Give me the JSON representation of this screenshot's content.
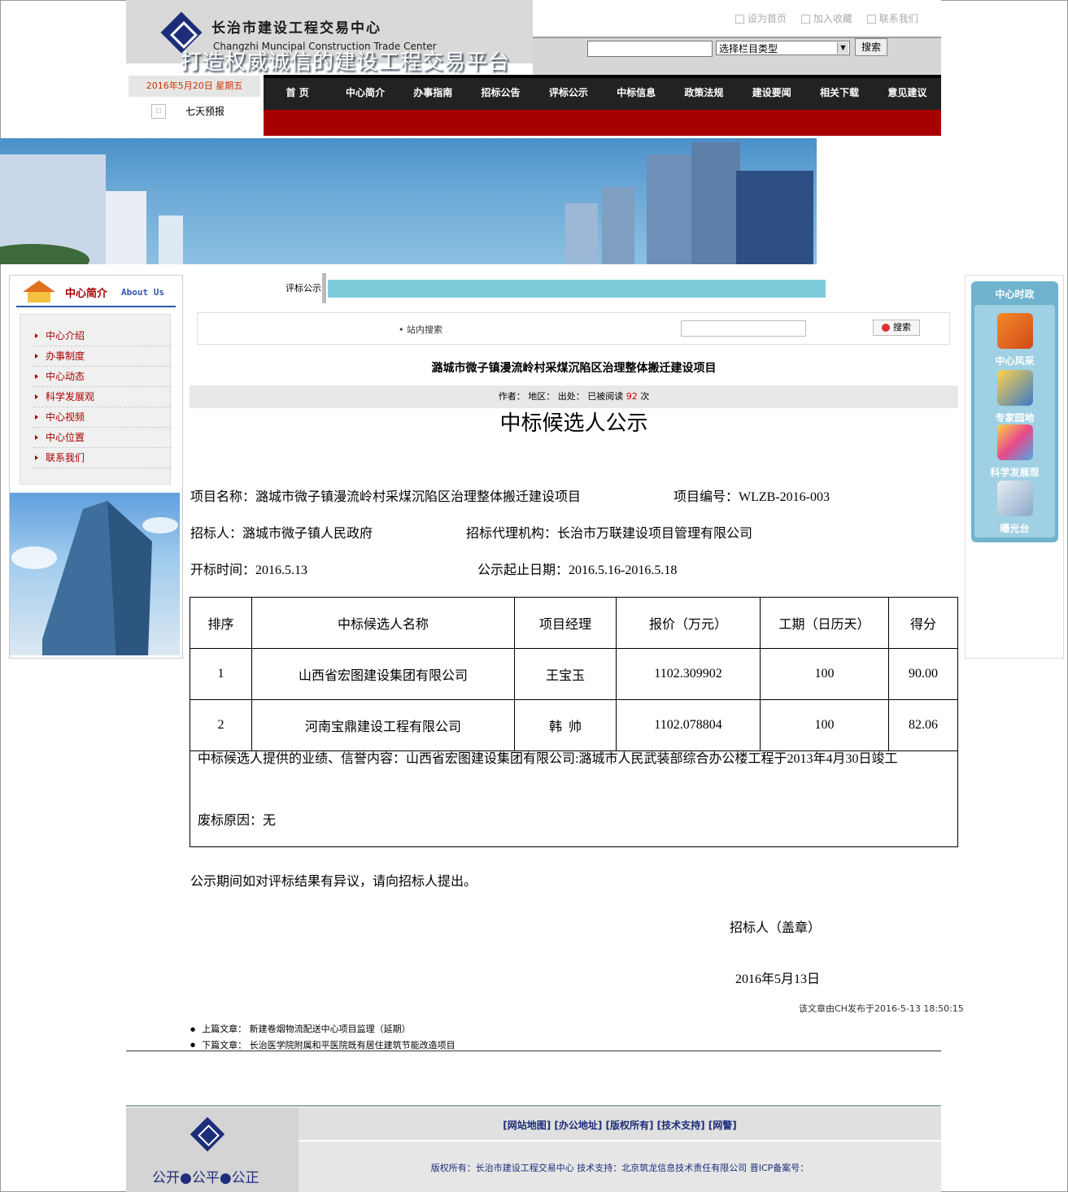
{
  "header": {
    "logo_cn": "长治市建设工程交易中心",
    "logo_en": "Changzhi Muncipal Construction Trade Center",
    "top_links": [
      "设为首页",
      "加入收藏",
      "联系我们"
    ],
    "search_select": "选择栏目类型",
    "search_button": "搜索",
    "date": "2016年5月20日  星期五",
    "weather": "七天预报"
  },
  "nav": [
    "首 页",
    "中心简介",
    "办事指南",
    "招标公告",
    "评标公示",
    "中标信息",
    "政策法规",
    "建设要闻",
    "相关下载",
    "意见建议"
  ],
  "banner": {
    "slogan": "打造权威诚信的建设工程交易平台"
  },
  "left": {
    "title": "中心简介",
    "subtitle": "About Us",
    "menu": [
      "中心介绍",
      "办事制度",
      "中心动态",
      "科学发展观",
      "中心视频",
      "中心位置",
      "联系我们"
    ]
  },
  "right": {
    "title": "中心时政",
    "items": [
      "中心风采",
      "专家园地",
      "科学发展观",
      "曝光台"
    ]
  },
  "main": {
    "breadcrumb": "评标公示",
    "site_search_label": "• 站内搜索",
    "site_search_button": "搜索",
    "article_title": "潞城市微子镇漫流岭村采煤沉陷区治理整体搬迁建设项目",
    "meta": {
      "author": "作者：",
      "region": "地区：",
      "source": "出处：",
      "read_prefix": "已被阅读",
      "read_count": "92",
      "read_suffix": "次"
    },
    "heading": "中标候选人公示",
    "project_name": "项目名称：潞城市微子镇漫流岭村采煤沉陷区治理整体搬迁建设项目",
    "project_no": "项目编号：WLZB-2016-003",
    "tenderer": "招标人：潞城市微子镇人民政府",
    "agency": "招标代理机构：长治市万联建设项目管理有限公司",
    "open_time": "开标时间：2016.5.13",
    "notice_period": "公示起止日期：2016.5.16-2016.5.18",
    "table": {
      "headers": [
        "排序",
        "中标候选人名称",
        "项目经理",
        "报价（万元）",
        "工期（日历天）",
        "得分"
      ],
      "rows": [
        [
          "1",
          "山西省宏图建设集团有限公司",
          "王宝玉",
          "1102.309902",
          "100",
          "90.00"
        ],
        [
          "2",
          "河南宝鼎建设工程有限公司",
          "韩  帅",
          "1102.078804",
          "100",
          "82.06"
        ]
      ]
    },
    "performance_note": "中标候选人提供的业绩、信誉内容：山西省宏图建设集团有限公司:潞城市人民武装部综合办公楼工程于2013年4月30日竣工",
    "void_reason": "废标原因：无",
    "objection": "公示期间如对评标结果有异议，请向招标人提出。",
    "signature": "招标人（盖章）",
    "sign_date": "2016年5月13日",
    "published": "该文章由CH发布于2016-5-13 18:50:15",
    "prev": "上篇文章：  新建卷烟物流配送中心项目监理（延期）",
    "next": "下篇文章：  长治医学院附属和平医院既有居住建筑节能改造项目"
  },
  "footer": {
    "links": "[网站地图] [办公地址] [版权所有] [技术支持] [网警]",
    "copyright": "版权所有：长治市建设工程交易中心  技术支持：北京筑龙信息技术责任有限公司  晋ICP备案号：",
    "slogan": "公开●公平●公正"
  },
  "colors": {
    "nav_bg": "#222222",
    "accent_red": "#a80000",
    "brand_blue": "#1d2d7a",
    "side_blue": "#6fb3ce"
  }
}
